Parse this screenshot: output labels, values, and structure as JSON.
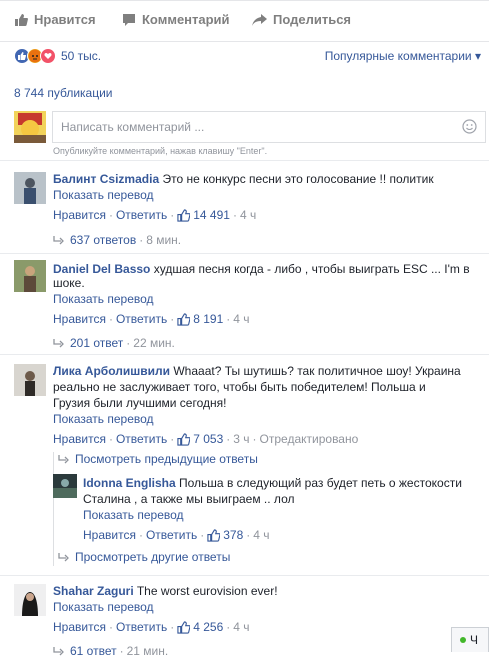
{
  "actions": {
    "like": "Нравится",
    "comment": "Комментарий",
    "share": "Поделиться"
  },
  "reactions": {
    "count": "50 тыс.",
    "sort": "Популярные комментарии ▾"
  },
  "publications": "8 744 публикации",
  "composer": {
    "placeholder": "Написать комментарий ...",
    "hint": "Опубликуйте комментарий, нажав клавишу \"Enter\"."
  },
  "common": {
    "translate": "Показать перевод",
    "like": "Нравится",
    "reply": "Ответить",
    "sep": "·"
  },
  "comments": [
    {
      "author": "Балинт Csizmadia",
      "text1": "Это не конкурс песни это голосование !! политик",
      "likes": "14 491",
      "time": "4 ч",
      "replies": "637 ответов",
      "replies_time": "8 мин."
    },
    {
      "author": "Daniel Del Basso",
      "text1": "худшая песня когда - либо , чтобы выиграть ESC ... I'm в",
      "text2": "шоке.",
      "likes": "8 191",
      "time": "4 ч",
      "replies": "201 ответ",
      "replies_time": "22 мин."
    },
    {
      "author": "Лика Арболишвили",
      "text1": "Whaaat? Ты шутишь? так политичное шоу! Украина",
      "text2": "реально не заслуживает того, чтобы быть победителем! Польша и",
      "text3": "Грузия были лучшими сегодня!",
      "likes": "7 053",
      "time": "3 ч",
      "edited": "Отредактировано",
      "prev_replies": "Посмотреть предыдущие ответы",
      "other_replies": "Просмотреть другие ответы",
      "reply": {
        "author": "Idonna Englisha",
        "text1": "Польша в следующий раз будет петь о жестокости",
        "text2": "Сталина , а также мы выиграем .. лол",
        "likes": "378",
        "time": "4 ч"
      }
    },
    {
      "author": "Shahar Zaguri",
      "text1": "The worst eurovision ever!",
      "likes": "4 256",
      "time": "4 ч",
      "replies": "61 ответ",
      "replies_time": "21 мин."
    }
  ],
  "chat": {
    "label": "Ч"
  }
}
